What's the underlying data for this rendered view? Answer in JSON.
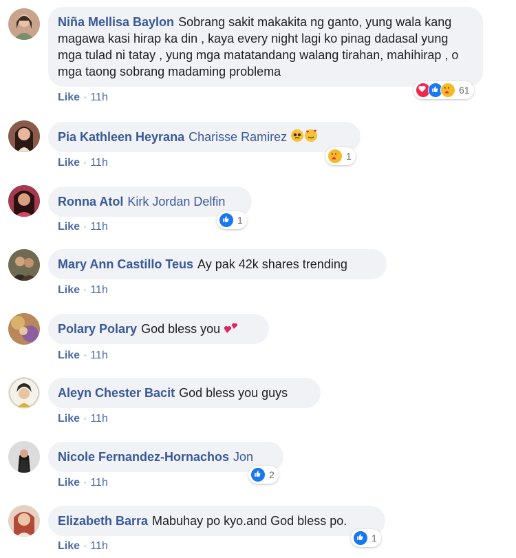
{
  "comments": [
    {
      "name": "Niña Mellisa Baylon",
      "text": "Sobrang sakit makakita ng ganto, yung wala kang magawa kasi hirap ka din , kaya every night lagi ko pinag dadasal yung mga tulad ni tatay , yung mga matatandang walang tirahan, mahihirap , o mga taong sobrang madaming problema",
      "like": "Like",
      "time": "11h",
      "reaction_count": "61"
    },
    {
      "name": "Pia Kathleen Heyrana",
      "tag": "Charisse Ramirez",
      "like": "Like",
      "time": "11h",
      "reaction_count": "1"
    },
    {
      "name": "Ronna Atol",
      "tag": "Kirk Jordan Delfin",
      "like": "Like",
      "time": "11h",
      "reaction_count": "1"
    },
    {
      "name": "Mary Ann Castillo Teus",
      "text": "Ay pak 42k shares trending",
      "like": "Like",
      "time": "11h"
    },
    {
      "name": "Polary Polary",
      "text": "God bless you",
      "like": "Like",
      "time": "11h"
    },
    {
      "name": "Aleyn Chester Bacit",
      "text": "God bless you guys",
      "like": "Like",
      "time": "11h"
    },
    {
      "name": "Nicole Fernandez-Hornachos",
      "tag": "Jon",
      "like": "Like",
      "time": "11h",
      "reaction_count": "2"
    },
    {
      "name": "Elizabeth Barra",
      "text": "Mabuhay po kyo.and God bless po.",
      "like": "Like",
      "time": "11h",
      "reaction_count": "1"
    }
  ],
  "colors": {
    "name_link": "#385898",
    "bubble_bg": "#f0f2f5",
    "like_blue": "#1877f2",
    "love_red": "#f02849",
    "care_yellow": "#f7b928"
  }
}
